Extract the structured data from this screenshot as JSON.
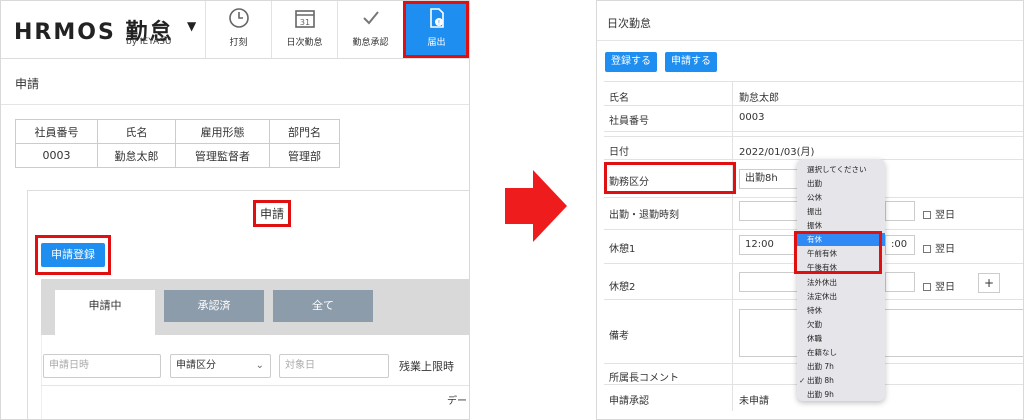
{
  "left": {
    "logo": "HRMOS 勤怠",
    "logo_sub": "by IEYASU",
    "nav": [
      {
        "label": "打刻",
        "icon": "clock-icon"
      },
      {
        "label": "日次勤怠",
        "icon": "calendar-icon"
      },
      {
        "label": "勤怠承認",
        "icon": "check-icon"
      },
      {
        "label": "届出",
        "icon": "document-icon"
      }
    ],
    "calendar_day": "31",
    "page_title": "申請",
    "info_headers": [
      "社員番号",
      "氏名",
      "雇用形態",
      "部門名"
    ],
    "info_values": [
      "0003",
      "勤怠太郎",
      "管理監督者",
      "管理部"
    ],
    "card_title": "申請",
    "register_button": "申請登録",
    "tabs": [
      "申請中",
      "承認済",
      "全て"
    ],
    "filter_date_placeholder": "申請日時",
    "filter_type": "申請区分",
    "filter_target_placeholder": "対象日",
    "overtime_label": "残業上限時",
    "data_cutoff": "デー"
  },
  "right": {
    "title": "日次勤怠",
    "buttons": [
      "登録する",
      "申請する"
    ],
    "rows": {
      "name_label": "氏名",
      "name_value": "勤怠太郎",
      "emp_label": "社員番号",
      "emp_value": "0003",
      "date_label": "日付",
      "date_value": "2022/01/03(月)",
      "work_type_label": "勤務区分",
      "work_type_value": "出勤8h",
      "inout_label": "出勤・退勤時刻",
      "break1_label": "休憩1",
      "break1_start": "12:00",
      "break1_end": ":00",
      "break2_label": "休憩2",
      "memo_label": "備考",
      "comment_label": "所属長コメント",
      "approval_label": "申請承認",
      "approval_value": "未申請",
      "next_day": "翌日",
      "plus": "+"
    },
    "dropdown": {
      "items": [
        "選択してください",
        "出勤",
        "公休",
        "振出",
        "振休",
        "有休",
        "午前有休",
        "午後有休",
        "法外休出",
        "法定休出",
        "特休",
        "欠勤",
        "休職",
        "在籍なし",
        "出勤 7h",
        "出勤 8h",
        "出勤 9h"
      ],
      "highlighted": "有休",
      "checked": "出勤 8h"
    }
  },
  "colors": {
    "accent": "#1f8ef1",
    "highlight": "#e01010",
    "tab_inactive": "#8c9cab"
  }
}
